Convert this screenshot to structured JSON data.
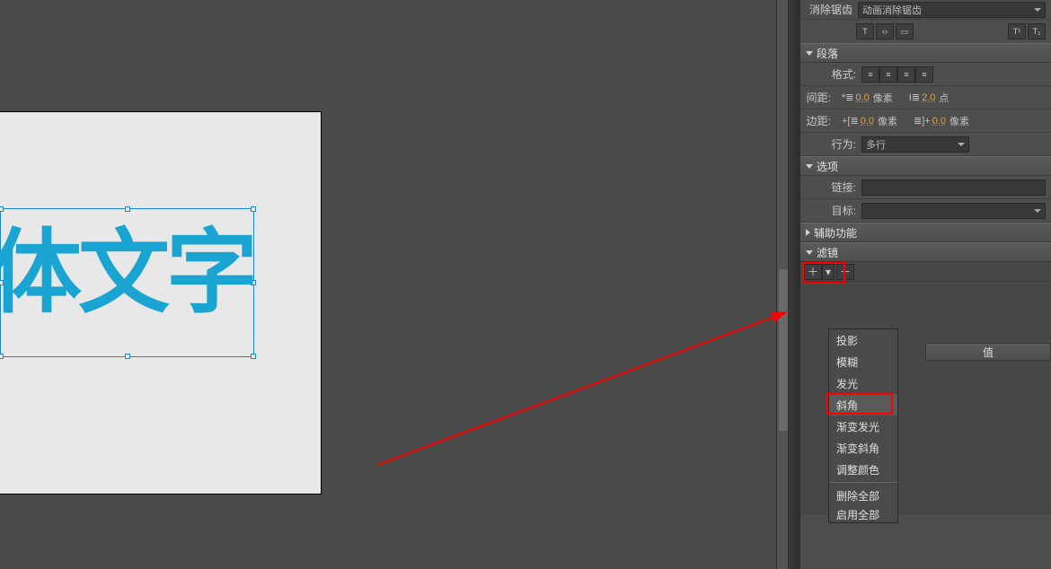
{
  "stage": {
    "text": "体文字"
  },
  "antialias": {
    "label": "消除锯齿",
    "value": "动画消除锯齿"
  },
  "toolbar_icons": [
    "T-bold",
    "chevrons",
    "box",
    "T-super",
    "T-sub"
  ],
  "paragraph": {
    "section": "段落",
    "format_label": "格式:",
    "alignments": [
      "left",
      "center",
      "right",
      "justify"
    ],
    "spacing_label": "间距:",
    "indent_value": "0.0",
    "indent_unit": "像素",
    "line_value": "2.0",
    "line_unit": "点",
    "margin_label": "边距:",
    "margin_left_value": "0.0",
    "margin_left_unit": "像素",
    "margin_right_value": "0.0",
    "margin_right_unit": "像素",
    "behavior_label": "行为:",
    "behavior_value": "多行"
  },
  "options": {
    "section": "选项",
    "link_label": "链接:",
    "link_value": "",
    "target_label": "目标:",
    "target_value": ""
  },
  "accessibility": {
    "section": "辅助功能"
  },
  "filters": {
    "section": "滤镜",
    "value_header": "值",
    "menu": [
      "投影",
      "模糊",
      "发光",
      "斜角",
      "渐变发光",
      "渐变斜角",
      "调整颜色"
    ],
    "remove_all": "删除全部",
    "enable_all": "启用全部"
  }
}
